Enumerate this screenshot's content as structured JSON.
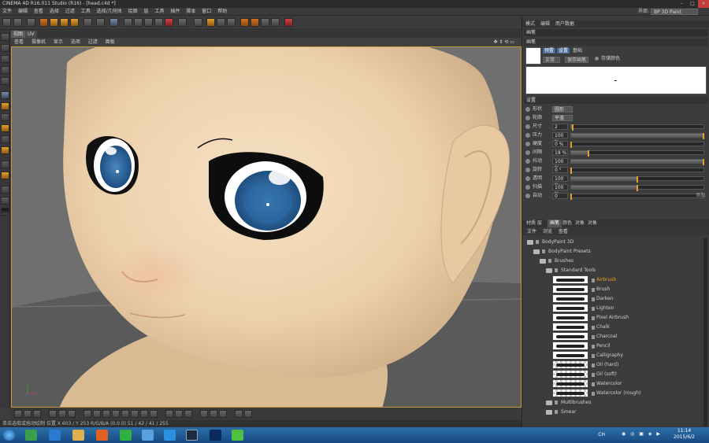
{
  "window": {
    "title": "CINEMA 4D R16.011 Studio (R16) - [head.c4d *]"
  },
  "menu": [
    "文件",
    "编辑",
    "查看",
    "选择",
    "过滤",
    "工具",
    "选择/几何体",
    "绘图",
    "层",
    "工具",
    "插件",
    "脚本",
    "窗口",
    "帮助"
  ],
  "layout": {
    "label": "界面:",
    "value": "BP 3D Paint"
  },
  "viewport": {
    "tabs": [
      "视图",
      "UV"
    ],
    "menu": [
      "查看",
      "摄像机",
      "显示",
      "选项",
      "过滤",
      "面板"
    ]
  },
  "status": {
    "text": "单击选取或拖动绘制 位置 X 603 / Y 253 R/G/B/A (0.0.0) 51 / 42 / 41 / 255"
  },
  "attributes": {
    "header_tabs": [
      "模式",
      "编辑",
      "用户数据"
    ],
    "brush_title": "画笔",
    "brush_section": "画笔",
    "preset_tabs": [
      "预置",
      "设置",
      "基础"
    ],
    "dropdown_value": "正常",
    "save_button": "保存画笔",
    "keep_color_label": "存储颜色",
    "settings_section": "设置",
    "params": [
      {
        "label": "形状",
        "type": "dropdown",
        "value": "圆形"
      },
      {
        "label": "轮廓",
        "type": "dropdown",
        "value": "平滑"
      },
      {
        "label": "尺寸",
        "value": "2",
        "level": 0.01
      },
      {
        "label": "压力",
        "value": "100 %",
        "level": 1.0
      },
      {
        "label": "硬度",
        "value": "0 %",
        "level": 0.0
      },
      {
        "label": "间隔",
        "value": "18 %",
        "level": 0.13
      },
      {
        "label": "抖动",
        "value": "100 %",
        "level": 1.0
      },
      {
        "label": "旋转",
        "value": "0 °",
        "level": 0.0
      },
      {
        "label": "透明",
        "value": "100 %",
        "level": 0.5
      },
      {
        "label": "扫描",
        "value": "100 %",
        "level": 0.5
      },
      {
        "label": "自动",
        "value": "0",
        "level": 0
      }
    ],
    "extra_right": "添加"
  },
  "browser": {
    "tabs": [
      "材质",
      "层",
      "画笔",
      "颜色",
      "对象",
      "对象"
    ],
    "active_tab": 2,
    "menu": [
      "文件",
      "浏览",
      "查看"
    ],
    "tree": [
      {
        "label": "BodyPaint 3D",
        "level": 0
      },
      {
        "label": "BodyPaint Presets",
        "level": 1
      },
      {
        "label": "Brushes",
        "level": 2
      },
      {
        "label": "Standard Tools",
        "level": 3
      }
    ],
    "brushes": [
      {
        "name": "Airbrush",
        "selected": true,
        "checker": false
      },
      {
        "name": "Brush",
        "selected": false,
        "checker": false
      },
      {
        "name": "Darken",
        "selected": false,
        "checker": false
      },
      {
        "name": "Lighten",
        "selected": false,
        "checker": false
      },
      {
        "name": "Pixel Airbrush",
        "selected": false,
        "checker": false
      },
      {
        "name": "Chalk",
        "selected": false,
        "checker": false
      },
      {
        "name": "Charcoal",
        "selected": false,
        "checker": false
      },
      {
        "name": "Pencil",
        "selected": false,
        "checker": false
      },
      {
        "name": "Calligraphy",
        "selected": false,
        "checker": false
      },
      {
        "name": "Oil (hard)",
        "selected": false,
        "checker": true
      },
      {
        "name": "Oil (soft)",
        "selected": false,
        "checker": true
      },
      {
        "name": "Watercolor",
        "selected": false,
        "checker": true
      },
      {
        "name": "Watercolor (rough)",
        "selected": false,
        "checker": true
      }
    ],
    "tree_after": [
      {
        "label": "Multibrushes",
        "level": 2
      },
      {
        "label": "Smear",
        "level": 2
      }
    ]
  },
  "taskbar": {
    "lang": "CH",
    "time": "11:14",
    "date": "2015/6/2"
  }
}
